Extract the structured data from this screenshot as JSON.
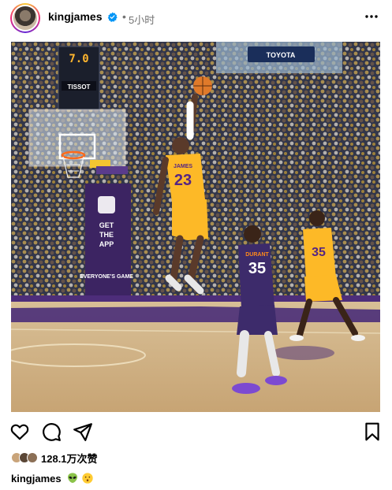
{
  "post": {
    "username": "kingjames",
    "dot": "•",
    "time": "5小时",
    "photo": {
      "scoreboard_time": "7.0",
      "scoreboard_sponsor": "TISSOT",
      "arena_sponsor": "TOYOTA",
      "banner_text_1": "GET",
      "banner_text_2": "THE",
      "banner_text_3": "APP",
      "banner_brand": "EVERYONE'S GAME",
      "player_main_number": "23",
      "player_main_name": "JAMES",
      "player_defender_number": "35",
      "player_defender_name": "DURANT",
      "player_teammate_number": "35"
    },
    "likes_text": "128.1万次赞",
    "caption_user": "kingjames",
    "caption_emojis": [
      "alien-emoji",
      "kissing-face-emoji"
    ]
  },
  "icons": {
    "like": "heart-icon",
    "comment": "comment-icon",
    "share": "send-icon",
    "save": "bookmark-icon",
    "more": "more-options-icon",
    "verified": "verified-badge-icon"
  },
  "colors": {
    "lakers_gold": "#fdb927",
    "lakers_purple": "#552583",
    "suns_purple": "#3d2b6b",
    "instagram_blue": "#0095f6",
    "muted_text": "#737373"
  }
}
